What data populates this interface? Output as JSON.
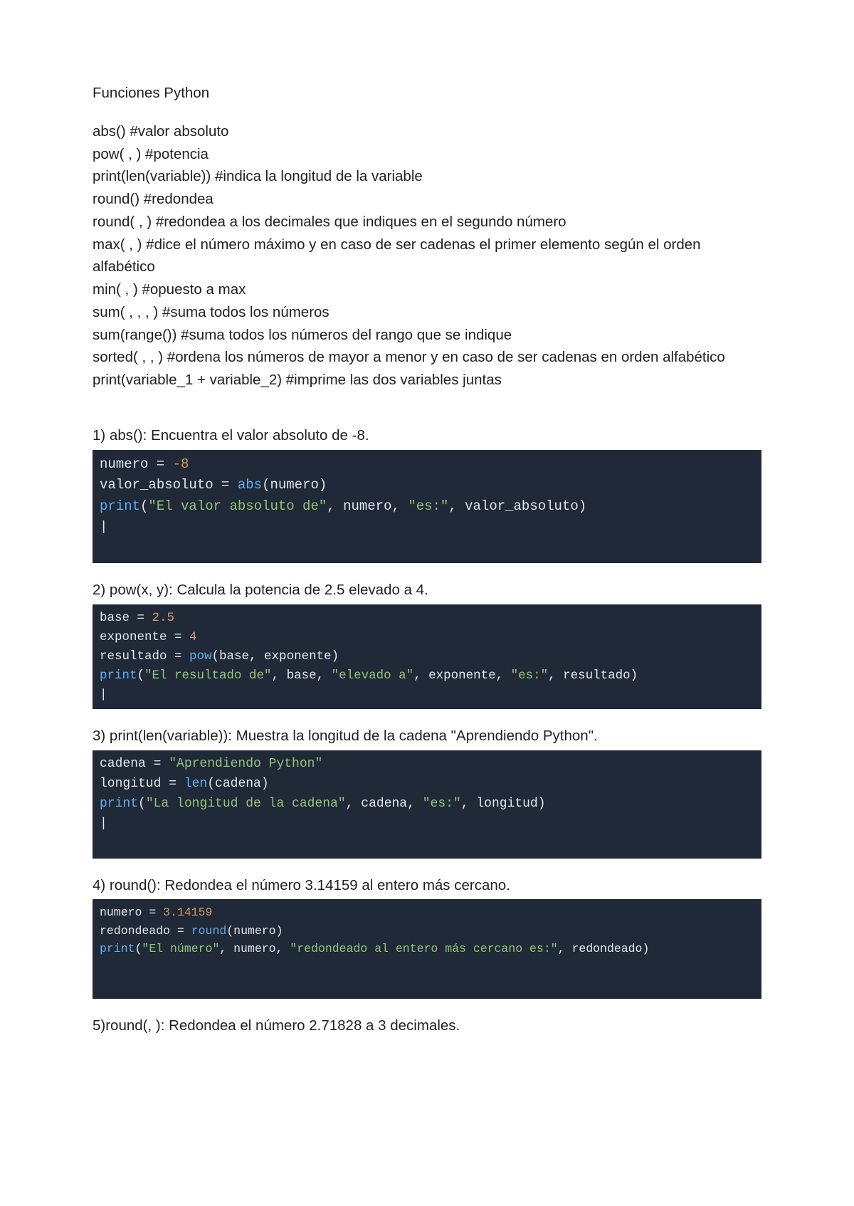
{
  "title": "Funciones Python",
  "notes": [
    "abs() #valor absoluto",
    "pow( , )  #potencia",
    "print(len(variable))  #indica la longitud de la variable",
    "round()  #redondea",
    "round( , )  #redondea a los decimales que indiques en el segundo número",
    "max( , )  #dice el número máximo y en caso de ser cadenas el primer elemento según el orden alfabético",
    "min( , ) #opuesto a max",
    "sum( , , , ) #suma todos los números",
    "sum(range()) #suma todos los números del rango que se indique",
    "sorted( , , ) #ordena los números de mayor a menor y en caso de ser cadenas en orden alfabético",
    "print(variable_1 + variable_2) #imprime las dos variables juntas"
  ],
  "exercises": {
    "e1": {
      "label": "1) abs(): Encuentra el valor absoluto de -8.",
      "code": {
        "l1a": "numero",
        "l1b": " = ",
        "l1c": "-8",
        "l2a": "valor_absoluto",
        "l2b": " = ",
        "l2c": "abs",
        "l2d": "(numero)",
        "l3a": "print",
        "l3b": "(",
        "l3c": "\"El valor absoluto de\"",
        "l3d": ", numero, ",
        "l3e": "\"es:\"",
        "l3f": ", valor_absoluto)"
      }
    },
    "e2": {
      "label": "2) pow(x, y): Calcula la potencia de 2.5 elevado a 4.",
      "code": {
        "l1a": "base",
        "l1b": " = ",
        "l1c": "2.5",
        "l2a": "exponente",
        "l2b": " = ",
        "l2c": "4",
        "l3a": "resultado",
        "l3b": " = ",
        "l3c": "pow",
        "l3d": "(base, exponente)",
        "l4a": "print",
        "l4b": "(",
        "l4c": "\"El resultado de\"",
        "l4d": ", base, ",
        "l4e": "\"elevado a\"",
        "l4f": ", exponente, ",
        "l4g": "\"es:\"",
        "l4h": ", resultado)"
      }
    },
    "e3": {
      "label": "3) print(len(variable)): Muestra la longitud de la cadena \"Aprendiendo Python\".",
      "code": {
        "l1a": "cadena",
        "l1b": " = ",
        "l1c": "\"Aprendiendo Python\"",
        "l2a": "longitud",
        "l2b": " = ",
        "l2c": "len",
        "l2d": "(cadena)",
        "l3a": "print",
        "l3b": "(",
        "l3c": "\"La longitud de la cadena\"",
        "l3d": ", cadena, ",
        "l3e": "\"es:\"",
        "l3f": ", longitud)"
      }
    },
    "e4": {
      "label": "4) round(): Redondea el número 3.14159 al entero más cercano.",
      "code": {
        "l1a": "numero",
        "l1b": " = ",
        "l1c": "3.14159",
        "l2a": "redondeado",
        "l2b": " = ",
        "l2c": "round",
        "l2d": "(numero)",
        "l3a": "print",
        "l3b": "(",
        "l3c": "\"El número\"",
        "l3d": ", numero, ",
        "l3e": "\"redondeado al entero más cercano es:\"",
        "l3f": ", redondeado)"
      }
    },
    "e5": {
      "label": "5)round(, ): Redondea el número 2.71828 a 3 decimales."
    }
  }
}
